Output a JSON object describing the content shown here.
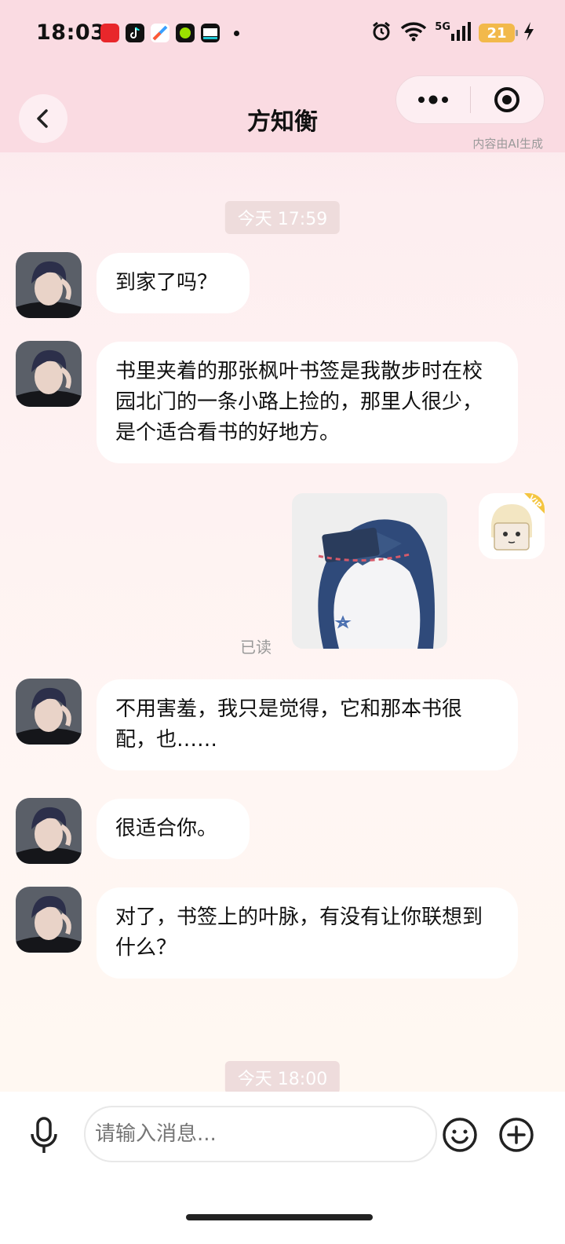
{
  "status_bar": {
    "time": "18:03",
    "network": "5G",
    "battery": "21",
    "notification_apps": [
      "tmall-icon",
      "tiktok-icon",
      "browser-icon",
      "app-green-icon",
      "video-app-icon"
    ]
  },
  "nav": {
    "title": "方知衡",
    "ai_note": "内容由AI生成"
  },
  "messages": {
    "ts1": "今天 17:59",
    "m1": "到家了吗？",
    "m2": "书里夹着的那张枫叶书签是我散步时在校园北门的一条小路上捡的，那里人很少，是个适合看书的好地方。",
    "read_status": "已读",
    "m3": "不用害羞，我只是觉得，它和那本书很配，也……",
    "m4": "很适合你。",
    "m5": "对了，书签上的叶脉，有没有让你联想到什么？",
    "ts2": "今天 18:00"
  },
  "user": {
    "badge": "VIP"
  },
  "input": {
    "placeholder": "请输入消息..."
  },
  "colors": {
    "header_bg": "#fadbe2",
    "bubble_bg": "#ffffff",
    "timestamp_bg": "#eedcdc",
    "battery": "#f2b94b",
    "vip": "#f4c540"
  }
}
